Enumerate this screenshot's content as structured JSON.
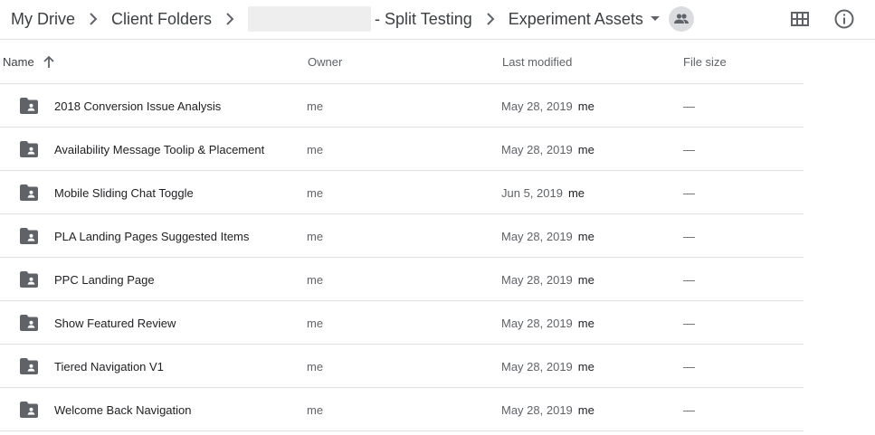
{
  "breadcrumb": {
    "items": [
      {
        "label": "My Drive"
      },
      {
        "label": "Client Folders"
      },
      {
        "label": "- Split Testing"
      },
      {
        "label": "Experiment Assets"
      }
    ]
  },
  "columns": {
    "name": "Name",
    "owner": "Owner",
    "last_modified": "Last modified",
    "file_size": "File size"
  },
  "files": [
    {
      "name": "2018 Conversion Issue Analysis",
      "owner": "me",
      "modified": "May 28, 2019",
      "modified_by": "me",
      "size": "—"
    },
    {
      "name": "Availability Message Toolip & Placement",
      "owner": "me",
      "modified": "May 28, 2019",
      "modified_by": "me",
      "size": "—"
    },
    {
      "name": "Mobile Sliding Chat Toggle",
      "owner": "me",
      "modified": "Jun 5, 2019",
      "modified_by": "me",
      "size": "—"
    },
    {
      "name": "PLA Landing Pages Suggested Items",
      "owner": "me",
      "modified": "May 28, 2019",
      "modified_by": "me",
      "size": "—"
    },
    {
      "name": "PPC Landing Page",
      "owner": "me",
      "modified": "May 28, 2019",
      "modified_by": "me",
      "size": "—"
    },
    {
      "name": "Show Featured Review",
      "owner": "me",
      "modified": "May 28, 2019",
      "modified_by": "me",
      "size": "—"
    },
    {
      "name": "Tiered Navigation V1",
      "owner": "me",
      "modified": "May 28, 2019",
      "modified_by": "me",
      "size": "—"
    },
    {
      "name": "Welcome Back Navigation",
      "owner": "me",
      "modified": "May 28, 2019",
      "modified_by": "me",
      "size": "—"
    }
  ],
  "icons": {
    "folder": "shared-folder-icon",
    "sort": "arrow-up-icon",
    "grid": "grid-view-icon",
    "info": "info-icon",
    "shared": "people-icon"
  },
  "colors": {
    "icon_gray": "#5f6368",
    "divider": "#e0e0e0",
    "text_primary": "#202124",
    "text_secondary": "#5f6368"
  }
}
